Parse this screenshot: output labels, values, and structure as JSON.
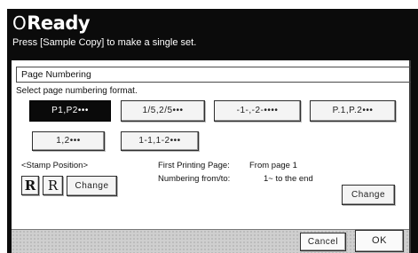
{
  "status": {
    "icon": "circle-indicator-icon",
    "circle": "O",
    "text": "Ready"
  },
  "hint": "Press [Sample Copy] to make a single set.",
  "panel": {
    "title": "Page Numbering",
    "prompt": "Select page numbering format.",
    "formats": [
      "P1,P2•••",
      "1/5,2/5•••",
      "-1-,-2-••••",
      "P.1,P.2•••",
      "1,2•••",
      "1-1,1-2•••"
    ],
    "selected_format": "P1,P2•••",
    "stamp_position_label": "<Stamp Position>",
    "stamp_icons": [
      "R",
      "R"
    ],
    "stamp_change_label": "Change",
    "first_printing_page_label": "First Printing Page:",
    "first_printing_page_value": "From page   1",
    "numbering_label": "Numbering from/to:",
    "numbering_value": "1~ to the end",
    "numbering_change_label": "Change"
  },
  "footer": {
    "cancel_label": "Cancel",
    "ok_label": "OK"
  }
}
